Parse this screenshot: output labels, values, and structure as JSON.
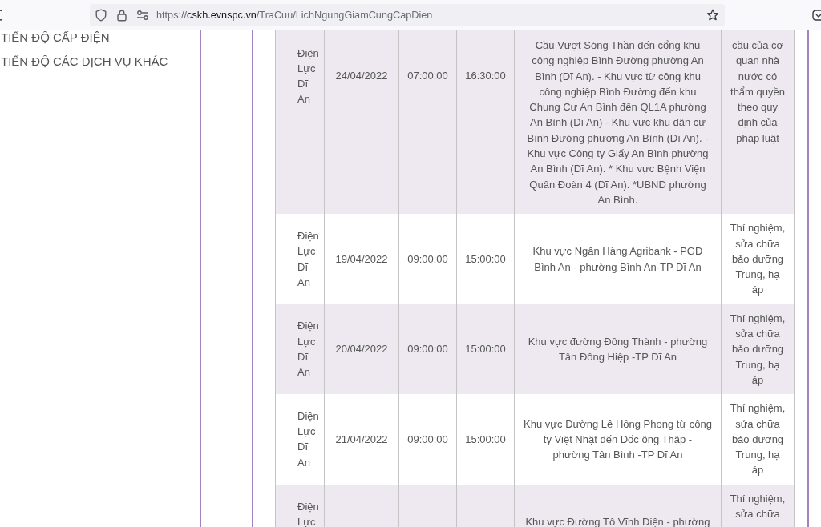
{
  "browser": {
    "url": {
      "scheme": "https://",
      "host": "cskh.evnspc.vn",
      "path": "/TraCuu/LichNgungGiamCungCapDien"
    }
  },
  "sidebar": {
    "items": [
      {
        "label": "TIẾN ĐỘ CẤP ĐIỆN"
      },
      {
        "label": "TIẾN ĐỘ CÁC DỊCH VỤ KHÁC"
      }
    ]
  },
  "table": {
    "rows": [
      {
        "column_1": "Điện Lực Dĩ An",
        "column_2": "24/04/2022",
        "column_3": "07:00:00",
        "column_4": "16:30:00",
        "column_5": "Cầu Vượt Sóng Thần đến cổng khu\ncông nghiệp Bình Đường phường An\nBình (Dĩ An). - Khu vực từ công khu\ncông nghiệp Bình Đường đến khu\nChung Cư An Bình đến QL1A phường\nAn Bình (Dĩ An) - Khu vực khu dân cư\nBình Đường phường An Bình (Dĩ An). -\nKhu vực Công ty Giấy An Bình phường\nAn Bình (Dĩ An). * Khu vực Bệnh Viện\nQuân Đoàn 4 (Dĩ An). *UBND phường\nAn Bình.",
        "column_6": "cầu của cơ quan nhà nước có thẩm quyền theo quy định của pháp luật"
      },
      {
        "column_1": "Điện Lực Dĩ An",
        "column_2": "19/04/2022",
        "column_3": "09:00:00",
        "column_4": "15:00:00",
        "column_5": "Khu vực Ngân Hàng Agribank - PGD\nBình An - phường Bình An-TP Dĩ An",
        "column_6": "Thí nghiệm, sửa chữa bảo dưỡng Trung, hạ áp"
      },
      {
        "column_1": "Điện Lực Dĩ An",
        "column_2": "20/04/2022",
        "column_3": "09:00:00",
        "column_4": "15:00:00",
        "column_5": "Khu vực đường Đông Thành - phường\nTân Đông Hiệp -TP Dĩ An",
        "column_6": "Thí nghiệm, sửa chữa bảo dưỡng Trung, hạ áp"
      },
      {
        "column_1": "Điện Lực Dĩ An",
        "column_2": "21/04/2022",
        "column_3": "09:00:00",
        "column_4": "15:00:00",
        "column_5": "Khu vực Đường Lê Hồng Phong từ công\nty Việt Nhật đến Dốc ông Thập -\nphường Tân Bình -TP Dĩ An",
        "column_6": "Thí nghiệm, sửa chữa bảo dưỡng Trung, hạ áp"
      },
      {
        "column_1": "Điện Lực",
        "column_5": "Khu vực Đường Tô Vĩnh Diện - phường",
        "column_6": "Thí nghiệm, sửa chữa"
      }
    ]
  }
}
